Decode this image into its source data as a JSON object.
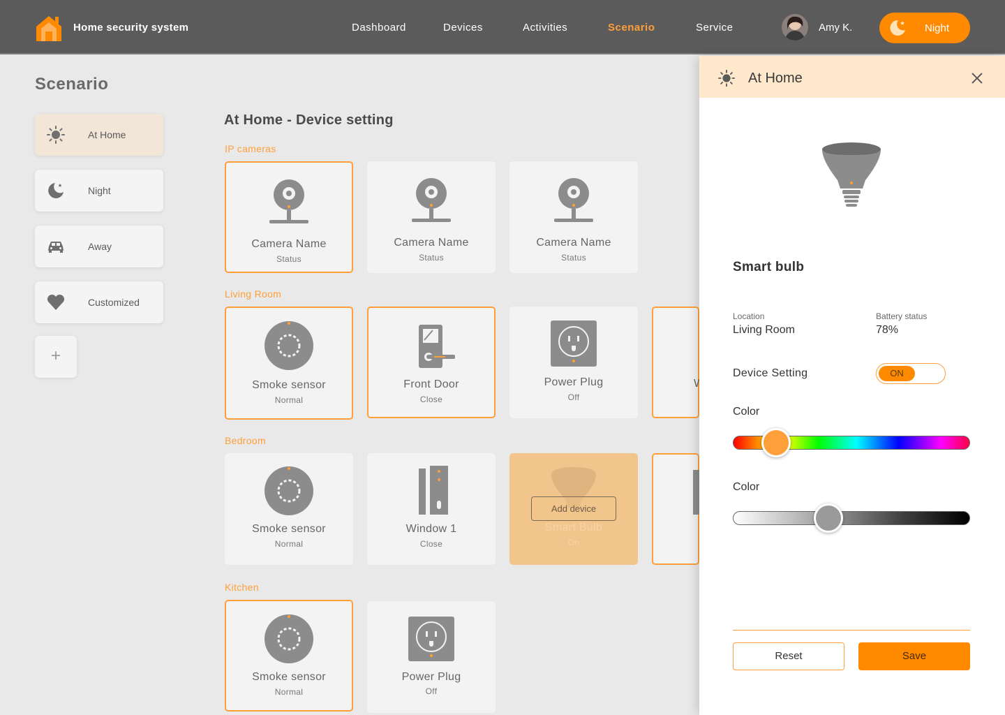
{
  "header": {
    "app_title": "Home security system",
    "nav": [
      "Dashboard",
      "Devices",
      "Activities",
      "Scenario",
      "Service"
    ],
    "active_nav": "Scenario",
    "user_name": "Amy K.",
    "mode_label": "Night"
  },
  "sidebar": {
    "title": "Scenario",
    "items": [
      {
        "label": "At Home",
        "icon": "sun-icon",
        "active": true
      },
      {
        "label": "Night",
        "icon": "moon-icon",
        "active": false
      },
      {
        "label": "Away",
        "icon": "car-icon",
        "active": false
      },
      {
        "label": "Customized",
        "icon": "heart-icon",
        "active": false
      }
    ],
    "add_label": "+"
  },
  "main": {
    "title": "At Home - Device setting",
    "groups": {
      "ip_cameras": "IP cameras",
      "living_room": "Living Room",
      "bedroom": "Bedroom",
      "kitchen": "Kitchen"
    },
    "cameras": [
      {
        "name": "Camera Name",
        "status": "Status",
        "selected": true
      },
      {
        "name": "Camera Name",
        "status": "Status",
        "selected": false
      },
      {
        "name": "Camera Name",
        "status": "Status",
        "selected": false
      }
    ],
    "living": [
      {
        "name": "Smoke sensor",
        "status": "Normal",
        "icon": "smoke-sensor-icon",
        "selected": true
      },
      {
        "name": "Front Door",
        "status": "Close",
        "icon": "door-lock-icon",
        "selected": true
      },
      {
        "name": "Power Plug",
        "status": "Off",
        "icon": "power-plug-icon",
        "selected": false
      },
      {
        "name": "W",
        "status": "",
        "icon": "",
        "selected": true
      }
    ],
    "bedroom": [
      {
        "name": "Smoke sensor",
        "status": "Normal",
        "icon": "smoke-sensor-icon",
        "selected": false
      },
      {
        "name": "Window 1",
        "status": "Close",
        "icon": "window-sensor-icon",
        "selected": false
      },
      {
        "name": "Smart Bulb",
        "status": "On",
        "icon": "bulb-icon",
        "selected": false,
        "add_label": "Add device"
      }
    ],
    "kitchen": [
      {
        "name": "Smoke sensor",
        "status": "Normal",
        "icon": "smoke-sensor-icon",
        "selected": true
      },
      {
        "name": "Power Plug",
        "status": "Off",
        "icon": "power-plug-icon",
        "selected": false
      }
    ]
  },
  "panel": {
    "title": "At Home",
    "device_name": "Smart bulb",
    "location_label": "Location",
    "location_value": "Living Room",
    "battery_label": "Battery status",
    "battery_value": "78%",
    "setting_label": "Device Setting",
    "toggle_value": "ON",
    "color_label_1": "Color",
    "color_label_2": "Color",
    "hue_level": 0.18,
    "brightness_level": 0.4,
    "hue_color": "#ff9f3a",
    "reset_label": "Reset",
    "save_label": "Save"
  },
  "colors": {
    "accent": "#ff8a00",
    "accent_light": "#ff9f3a",
    "topbar": "#5b5b5b",
    "panel_header": "#ffe8cc"
  }
}
